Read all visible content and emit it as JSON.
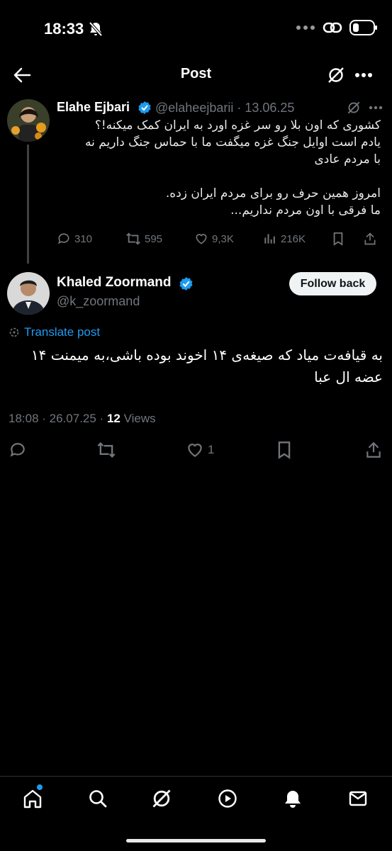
{
  "status_bar": {
    "time": "18:33",
    "icons": [
      "bell-mute-icon",
      "dots-icon",
      "link-icon",
      "battery-icon"
    ]
  },
  "header": {
    "title": "Post",
    "back_icon": "back-arrow-icon",
    "grok_icon": "grok-icon",
    "more_icon": "more-icon"
  },
  "quoted_post": {
    "author_name": "Elahe Ejbari",
    "handle_date": "@elaheejbarii · 13.06.25",
    "text_lines": [
      "کشوری که اون بلا رو سر غزه اورد به ایران کمک میکنه!؟",
      "یادم است اوایل جنگ غزه میگفت ما با حماس جنگ داریم نه",
      "با مردم عادی",
      "امروز همین حرف رو برای مردم ایران زده.",
      "ما فرقی با اون مردم نداریم..."
    ],
    "replies": "310",
    "reposts": "595",
    "likes": "9,3K",
    "views": "216K"
  },
  "main_post": {
    "author_name": "Khaled Zoormand",
    "handle": "@k_zoormand",
    "follow_label": "Follow back",
    "translate_label": "Translate post",
    "text": "به قیافه‌ت میاد که صیغه‌ی ۱۴ اخوند بوده باشی،به میمنت ۱۴ عضه ال عبا",
    "timestamp": "18:08 · 26.07.25 · ",
    "views_count": "12",
    "views_label": " Views",
    "likes": "1"
  },
  "bottom_nav": {
    "items": [
      "home-icon",
      "search-icon",
      "grok-icon",
      "play-icon",
      "notifications-icon",
      "messages-icon"
    ]
  },
  "colors": {
    "background": "#000000",
    "accent": "#1d9bf0",
    "muted": "#71767b",
    "verified": "#1d9bf0"
  }
}
